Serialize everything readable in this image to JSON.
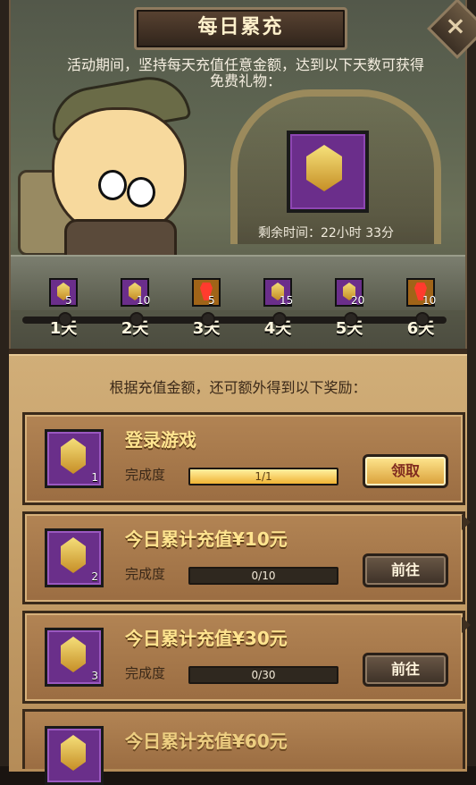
{
  "header": {
    "title": "每日累充",
    "close_label": "×"
  },
  "intro": {
    "text": "活动期间，坚持每天充值任意金额，达到以下天数可获得免费礼物："
  },
  "featured_reward": {
    "icon": "gold-crystal-icon",
    "remaining_time": "剩余时间：22小时 33分"
  },
  "days": [
    {
      "label": "1天",
      "count": "5",
      "icon": "gold-crystal-icon",
      "variant": "purple"
    },
    {
      "label": "2天",
      "count": "10",
      "icon": "gold-crystal-icon",
      "variant": "purple"
    },
    {
      "label": "3天",
      "count": "5",
      "icon": "red-emblem-icon",
      "variant": "gold"
    },
    {
      "label": "4天",
      "count": "15",
      "icon": "gold-crystal-icon",
      "variant": "purple"
    },
    {
      "label": "5天",
      "count": "20",
      "icon": "gold-crystal-icon",
      "variant": "purple"
    },
    {
      "label": "6天",
      "count": "10",
      "icon": "red-emblem-icon",
      "variant": "gold"
    }
  ],
  "extra": {
    "heading": "根据充值金额，还可额外得到以下奖励："
  },
  "tasks": [
    {
      "title": "登录游戏",
      "qty": "1",
      "progress_label": "完成度",
      "progress_text": "1/1",
      "progress": 1.0,
      "button": "领取",
      "button_type": "claim"
    },
    {
      "title": "今日累计充值¥10元",
      "qty": "2",
      "progress_label": "完成度",
      "progress_text": "0/10",
      "progress": 0.0,
      "button": "前往",
      "button_type": "go"
    },
    {
      "title": "今日累计充值¥30元",
      "qty": "3",
      "progress_label": "完成度",
      "progress_text": "0/30",
      "progress": 0.0,
      "button": "前往",
      "button_type": "go"
    }
  ],
  "partial_task": {
    "title": "今日累计充值¥60元"
  }
}
